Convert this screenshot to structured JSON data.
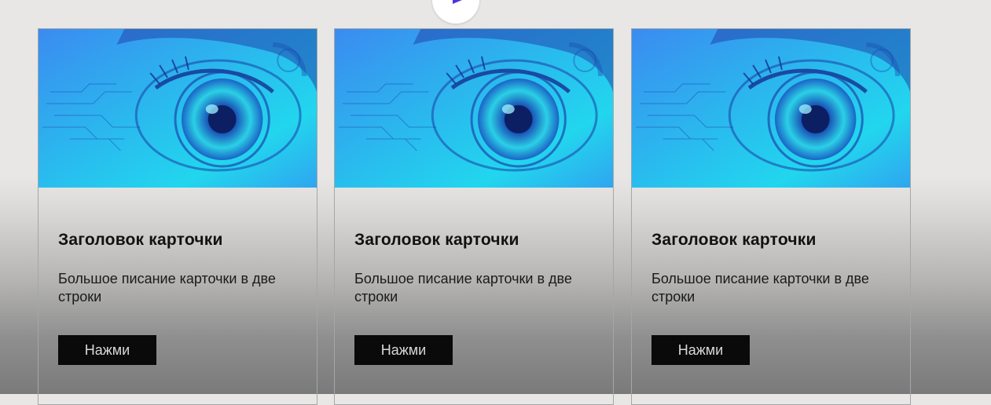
{
  "cards": [
    {
      "title": "Заголовок карточки",
      "description": "Большое писание карточки в две строки",
      "button_label": "Нажми",
      "image_icon": "cyber-eye-image"
    },
    {
      "title": "Заголовок карточки",
      "description": "Большое писание карточки в две строки",
      "button_label": "Нажми",
      "image_icon": "cyber-eye-image"
    },
    {
      "title": "Заголовок карточки",
      "description": "Большое писание карточки в две строки",
      "button_label": "Нажми",
      "image_icon": "cyber-eye-image"
    }
  ],
  "top_control": {
    "icon": "play-icon"
  },
  "colors": {
    "background_top": "#e8e7e5",
    "background_bottom": "#7a7a7a",
    "button_bg": "#0a0a0a",
    "button_text": "#d8d8d8",
    "accent": "#4b34e0",
    "image_blue": "#2f7ef0",
    "image_cyan": "#22e6f0"
  }
}
